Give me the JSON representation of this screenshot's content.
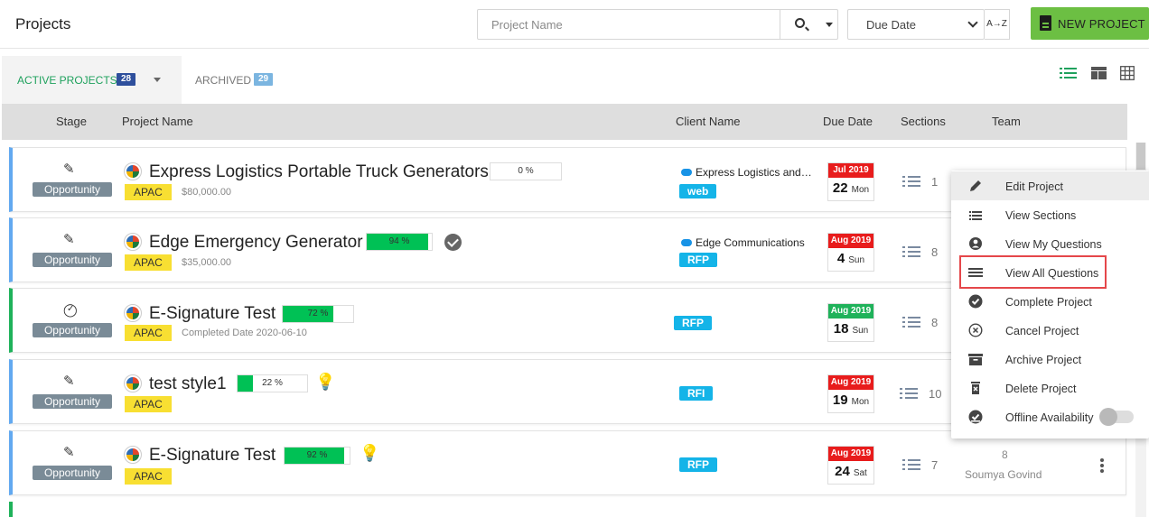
{
  "header": {
    "title": "Projects",
    "search_placeholder": "Project Name",
    "sort_value": "Due Date",
    "sort_direction_icon": "A→Z",
    "new_project_label": "NEW PROJECT",
    "accent": "#6cbf43"
  },
  "tabs": {
    "active_label": "ACTIVE PROJECTS",
    "active_count": "28",
    "archived_label": "ARCHIVED",
    "archived_count": "29"
  },
  "columns": {
    "stage": "Stage",
    "project_name": "Project Name",
    "client_name": "Client Name",
    "due_date": "Due Date",
    "sections": "Sections",
    "team": "Team"
  },
  "rows": [
    {
      "stage": "Opportunity",
      "stage_icon": "pencil-icon",
      "name": "Express Logistics Portable Truck Generators",
      "progress": 0,
      "progress_label": "0 %",
      "region": "APAC",
      "subtext": "$80,000.00",
      "client": "Express Logistics and …",
      "tag": "web",
      "month": "Jul 2019",
      "day": "22",
      "weekday": "Mon",
      "month_color": "#e81c1c",
      "sections": "1"
    },
    {
      "stage": "Opportunity",
      "stage_icon": "pencil-icon",
      "name": "Edge Emergency Generator",
      "progress": 94,
      "progress_label": "94 %",
      "region": "APAC",
      "subtext": "$35,000.00",
      "client": "Edge Communications",
      "tag": "RFP",
      "month": "Aug 2019",
      "day": "4",
      "weekday": "Sun",
      "month_color": "#e81c1c",
      "sections": "8"
    },
    {
      "stage": "Opportunity",
      "stage_icon": "check-circle-outline-icon",
      "name": "E-Signature Test",
      "progress": 72,
      "progress_label": "72 %",
      "region": "APAC",
      "subtext": "Completed Date 2020-06-10",
      "client": "",
      "tag": "RFP",
      "month": "Aug 2019",
      "day": "18",
      "weekday": "Sun",
      "month_color": "#1fb25a",
      "sections": "8"
    },
    {
      "stage": "Opportunity",
      "stage_icon": "pencil-icon",
      "name": "test style1",
      "progress": 22,
      "progress_label": "22 %",
      "region": "APAC",
      "subtext": "",
      "client": "",
      "tag": "RFI",
      "month": "Aug 2019",
      "day": "19",
      "weekday": "Mon",
      "month_color": "#e81c1c",
      "sections": "10"
    },
    {
      "stage": "Opportunity",
      "stage_icon": "pencil-icon",
      "name": "E-Signature Test",
      "progress": 92,
      "progress_label": "92 %",
      "region": "APAC",
      "subtext": "",
      "client": "",
      "tag": "RFP",
      "month": "Aug 2019",
      "day": "24",
      "weekday": "Sat",
      "month_color": "#e81c1c",
      "sections": "7",
      "team_count": "8",
      "team_member": "Soumya Govind"
    }
  ],
  "context_menu": {
    "items": [
      {
        "label": "Edit Project",
        "icon": "pencil-icon"
      },
      {
        "label": "View Sections",
        "icon": "list-icon"
      },
      {
        "label": "View My Questions",
        "icon": "user-circle-icon"
      },
      {
        "label": "View All Questions",
        "icon": "lines-icon"
      },
      {
        "label": "Complete Project",
        "icon": "check-circle-icon"
      },
      {
        "label": "Cancel Project",
        "icon": "x-circle-icon"
      },
      {
        "label": "Archive Project",
        "icon": "archive-icon"
      },
      {
        "label": "Delete Project",
        "icon": "trash-icon"
      },
      {
        "label": "Offline Availability",
        "icon": "offline-check-icon"
      }
    ],
    "highlighted": "View All Questions",
    "highlight_color": "#e5474a"
  }
}
